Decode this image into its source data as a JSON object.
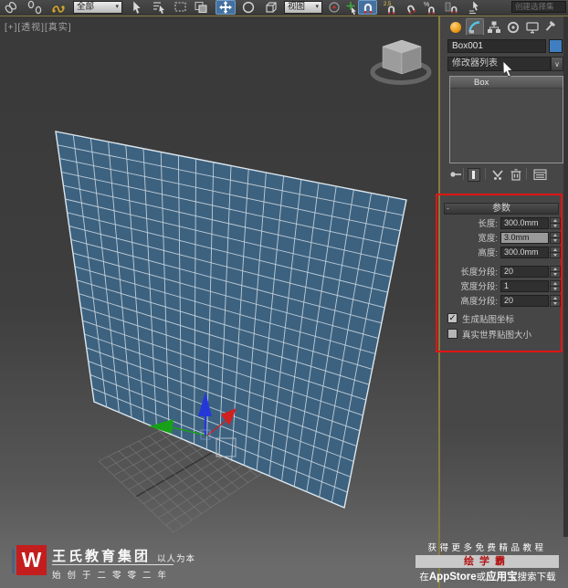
{
  "window": {
    "viewport_label": "[+][透视][真实]"
  },
  "toolbar": {
    "filter_value": "全部",
    "coord_value": "视图",
    "selection_set_value": "创建选择集"
  },
  "command_panel": {
    "object_name": "Box001",
    "modifier_list_value": "修改器列表",
    "modifier_stack": [
      "Box"
    ],
    "parameters": {
      "title": "参数",
      "collapse": "-",
      "rows": [
        {
          "label": "长度:",
          "value": "300.0mm"
        },
        {
          "label": "宽度:",
          "value": "3.0mm"
        },
        {
          "label": "高度:",
          "value": "300.0mm"
        },
        {
          "label": "长度分段:",
          "value": "20"
        },
        {
          "label": "宽度分段:",
          "value": "1"
        },
        {
          "label": "高度分段:",
          "value": "20"
        }
      ],
      "checkboxes": [
        {
          "label": "生成贴图坐标",
          "checked": true
        },
        {
          "label": "真实世界贴图大小",
          "checked": false
        }
      ]
    }
  },
  "footer": {
    "logo_letter": "W",
    "brand": "王氏教育集团",
    "slogan": "以人为本",
    "since": "始创于二零零二年",
    "promo_line": "获得更多免费精品教程",
    "promo_band": "绘学霸",
    "download_pre": "在",
    "download_store1": "AppStore",
    "download_mid": "或",
    "download_store2": "应用宝",
    "download_post": "搜索下载"
  },
  "icons": {
    "check": "✓",
    "chevron_down": "∨"
  },
  "colors": {
    "accent_blue": "#44719f",
    "object_color": "#3f7fc1",
    "highlight_red": "#e11414",
    "plane_fill": "#3d6280"
  }
}
